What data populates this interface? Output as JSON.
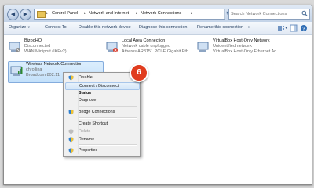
{
  "address": {
    "segments": [
      "Control Panel",
      "Network and Internet",
      "Network Connections"
    ]
  },
  "search": {
    "placeholder": "Search Network Connections"
  },
  "toolbar": {
    "organize": "Organize",
    "connect_to": "Connect To",
    "disable_device": "Disable this network device",
    "diagnose": "Diagnose this connection",
    "rename": "Rename this connection"
  },
  "connections": [
    {
      "name": "BizooHQ",
      "status": "Disconnected",
      "device": "WAN Miniport (IKEv2)"
    },
    {
      "name": "Local Area Connection",
      "status": "Network cable unplugged",
      "device": "Atheros AR8151 PCI-E Gigabit Eth..."
    },
    {
      "name": "VirtualBox Host-Only Network",
      "status": "Unidentified network",
      "device": "VirtualBox Host-Only Ethernet Ad..."
    },
    {
      "name": "Wireless Network Connection",
      "status": "chrollina",
      "device": "Broadcom 802.11"
    }
  ],
  "menu": {
    "items": [
      "Disable",
      "Connect / Disconnect",
      "Status",
      "Diagnose",
      "Bridge Connections",
      "Create Shortcut",
      "Delete",
      "Rename",
      "Properties"
    ]
  },
  "step_badge": "6",
  "colors": {
    "accent": "#e03c1e",
    "selection": "#c3e0fa"
  }
}
